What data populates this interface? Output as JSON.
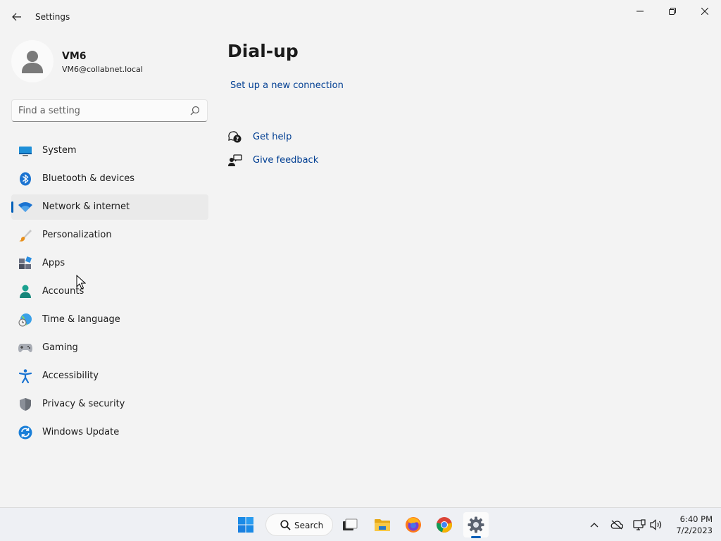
{
  "window": {
    "title": "Settings"
  },
  "profile": {
    "name": "VM6",
    "email": "VM6@collabnet.local"
  },
  "search": {
    "placeholder": "Find a setting"
  },
  "nav": {
    "items": [
      {
        "label": "System",
        "icon": "monitor-icon",
        "selected": false
      },
      {
        "label": "Bluetooth & devices",
        "icon": "bluetooth-icon",
        "selected": false
      },
      {
        "label": "Network & internet",
        "icon": "wifi-icon",
        "selected": true
      },
      {
        "label": "Personalization",
        "icon": "brush-icon",
        "selected": false
      },
      {
        "label": "Apps",
        "icon": "apps-icon",
        "selected": false
      },
      {
        "label": "Accounts",
        "icon": "person-icon",
        "selected": false
      },
      {
        "label": "Time & language",
        "icon": "globe-clock-icon",
        "selected": false
      },
      {
        "label": "Gaming",
        "icon": "gamepad-icon",
        "selected": false
      },
      {
        "label": "Accessibility",
        "icon": "accessibility-icon",
        "selected": false
      },
      {
        "label": "Privacy & security",
        "icon": "shield-icon",
        "selected": false
      },
      {
        "label": "Windows Update",
        "icon": "sync-icon",
        "selected": false
      }
    ]
  },
  "content": {
    "title": "Dial-up",
    "setup_link": "Set up a new connection",
    "get_help": "Get help",
    "give_feedback": "Give feedback"
  },
  "taskbar": {
    "search_label": "Search",
    "time": "6:40 PM",
    "date": "7/2/2023"
  },
  "colors": {
    "accent": "#005fb8",
    "link": "#003e92",
    "background": "#f3f3f3"
  }
}
